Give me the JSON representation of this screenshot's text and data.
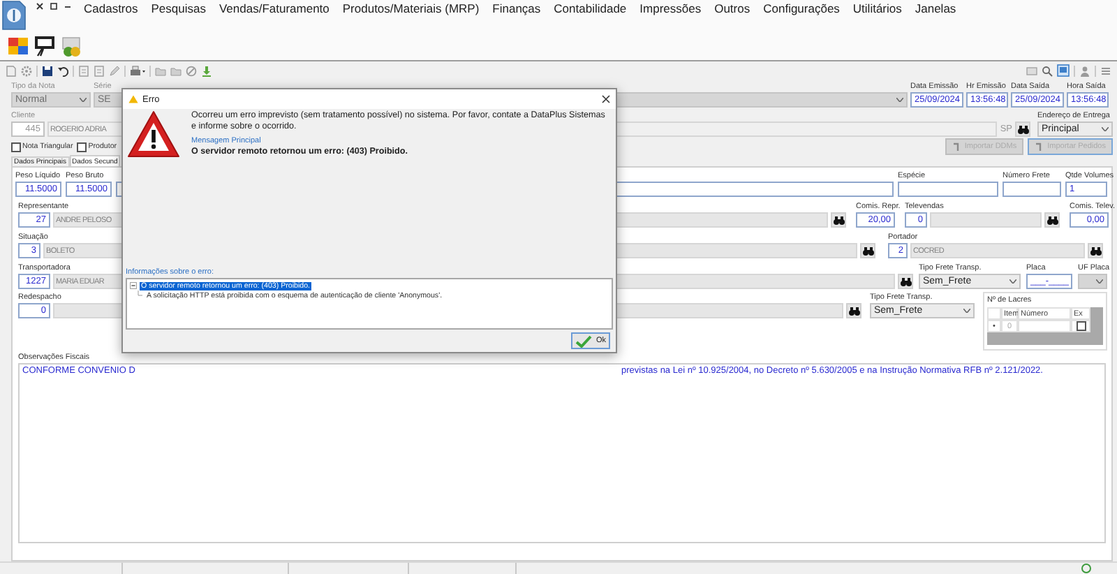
{
  "menu_bar": {
    "items": [
      "Cadastros",
      "Pesquisas",
      "Vendas/Faturamento",
      "Produtos/Materiais (MRP)",
      "Finanças",
      "Contabilidade",
      "Impressões",
      "Outros",
      "Configurações",
      "Utilitários",
      "Janelas"
    ]
  },
  "form": {
    "tipo_nota": {
      "label": "Tipo da Nota",
      "value": "Normal",
      "disabled": true
    },
    "serie": {
      "label": "Série",
      "value": "SE",
      "disabled": true
    },
    "dates": [
      {
        "label": "Data Emissão",
        "value": "25/09/2024"
      },
      {
        "label": "Hr Emissão",
        "value": "13:56:48"
      },
      {
        "label": "Data Saída",
        "value": "25/09/2024"
      },
      {
        "label": "Hora Saída",
        "value": "13:56:48"
      }
    ],
    "cliente": {
      "label": "Cliente",
      "code": "445",
      "description": "ROGERIO ADRIA",
      "uf": "SP",
      "disabled": true
    },
    "endereco_entrega": {
      "label": "Endereço de Entrega",
      "value": "Principal"
    },
    "checkboxes": [
      {
        "label": "Nota Triangular",
        "checked": false
      },
      {
        "label": "Produtor",
        "checked": false
      }
    ],
    "import_buttons": [
      {
        "label": "Importar DDMs",
        "disabled": true
      },
      {
        "label": "Importar Pedidos",
        "disabled": true
      }
    ],
    "tabs": [
      {
        "label": "Dados Principais",
        "selected": false
      },
      {
        "label": "Dados Secund",
        "selected": true
      }
    ]
  },
  "secondary": {
    "peso_liquido": {
      "label": "Peso Líquido",
      "value": "11.5000"
    },
    "peso_bruto": {
      "label": "Peso Bruto",
      "value": "11.5000"
    },
    "especie": {
      "label": "Espécie"
    },
    "numero_frete": {
      "label": "Número Frete"
    },
    "qtde_volumes": {
      "label": "Qtde Volumes",
      "value": "1"
    },
    "representante": {
      "label": "Representante",
      "code": "27",
      "description": "ANDRE PELOSO"
    },
    "comis_repr": {
      "label": "Comis. Repr.",
      "value": "20,00"
    },
    "televendas": {
      "label": "Televendas",
      "code": "0"
    },
    "comis_telev": {
      "label": "Comis. Telev.",
      "value": "0,00"
    },
    "situacao": {
      "label": "Situação",
      "code": "3",
      "description": "BOLETO"
    },
    "portador": {
      "label": "Portador",
      "code": "2",
      "description": "COCRED"
    },
    "transportadora": {
      "label": "Transportadora",
      "code": "1227",
      "description": "MARIA EDUAR"
    },
    "tipo_frete_transp": {
      "label": "Tipo Frete Transp.",
      "value": "Sem_Frete"
    },
    "placa": {
      "label": "Placa",
      "value": "___-____"
    },
    "uf_placa": {
      "label": "UF Placa"
    },
    "redespacho": {
      "label": "Redespacho",
      "code": "0"
    },
    "tipo_frete_redesp": {
      "label": "Tipo Frete Transp.",
      "value": "Sem_Frete"
    },
    "lacres": {
      "label": "Nº de Lacres",
      "columns": [
        "Item",
        "Número",
        "Ex"
      ],
      "rows": [
        {
          "indicator": "•",
          "item": "0",
          "ex_checked": false
        }
      ]
    },
    "observacoes": {
      "label": "Observações Fiscais",
      "text_start": "CONFORME CONVENIO D",
      "text_end": "previstas na Lei nº 10.925/2004, no Decreto nº 5.630/2005 e na Instrução Normativa RFB nº 2.121/2022."
    }
  },
  "dialog": {
    "title": "Erro",
    "message": "Ocorreu um erro imprevisto (sem tratamento possível) no sistema. Por favor, contate a DataPlus Sistemas e informe sobre o ocorrido.",
    "main_label": "Mensagem Principal",
    "main_message": "O servidor remoto retornou um erro: (403) Proibido.",
    "details_label": "Informações sobre o erro:",
    "details_tree": [
      {
        "text": "O servidor remoto retornou um erro: (403) Proibido.",
        "expanded": true,
        "selected": true,
        "children": [
          {
            "text": "A solicitação HTTP está proibida com o esquema de autenticação de cliente 'Anonymous'.",
            "selected": false
          }
        ]
      }
    ],
    "ok_button": "Ok"
  }
}
